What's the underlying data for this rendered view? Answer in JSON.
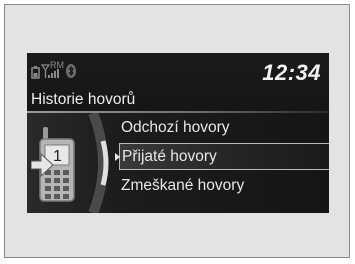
{
  "status": {
    "signal_label": "RM",
    "battery_icon": "battery-icon",
    "signal_icon": "signal-strength-icon",
    "bluetooth_icon": "bluetooth-icon",
    "clock": "12:34"
  },
  "header": {
    "title": "Historie hovorů"
  },
  "menu": {
    "items": [
      {
        "label": "Odchozí hovory",
        "selected": false
      },
      {
        "label": "Přijaté hovory",
        "selected": true
      },
      {
        "label": "Zmeškané hovory",
        "selected": false
      }
    ]
  },
  "category_icon": {
    "name": "incoming-call-phone-icon",
    "line_number": "1"
  }
}
